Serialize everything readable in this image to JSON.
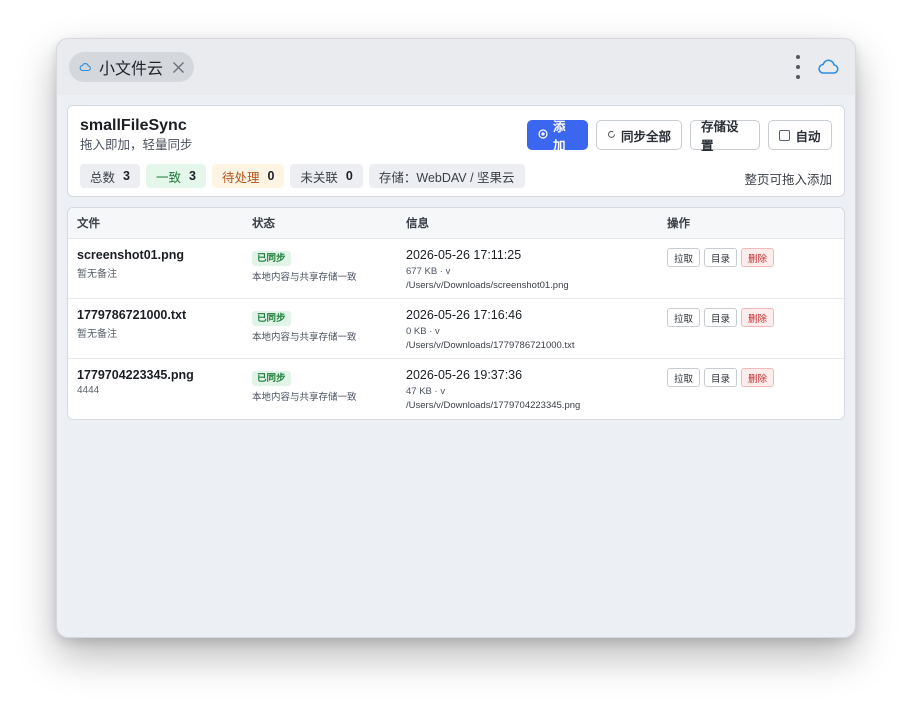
{
  "tab": {
    "title": "小文件云"
  },
  "header": {
    "title": "smallFileSync",
    "subtitle": "拖入即加，轻量同步",
    "buttons": {
      "add": "添加",
      "sync_all": "同步全部",
      "storage_settings": "存储设置",
      "auto": "自动"
    },
    "stats": {
      "total_label": "总数",
      "total_value": "3",
      "ok_label": "一致",
      "ok_value": "3",
      "pending_label": "待处理",
      "pending_value": "0",
      "unlinked_label": "未关联",
      "unlinked_value": "0",
      "storage_text": "存储：WebDAV / 坚果云"
    },
    "drop_hint": "整页可拖入添加"
  },
  "table": {
    "columns": [
      "文件",
      "状态",
      "信息",
      "操作"
    ],
    "rows": [
      {
        "name": "screenshot01.png",
        "note": "暂无备注",
        "status_badge": "已同步",
        "status_desc": "本地内容与共享存储一致",
        "time": "2026-05-26 17:11:25",
        "meta": "677 KB · v",
        "path": "/Users/v/Downloads/screenshot01.png",
        "ops": {
          "pull": "拉取",
          "dir": "目录",
          "delete": "删除"
        }
      },
      {
        "name": "1779786721000.txt",
        "note": "暂无备注",
        "status_badge": "已同步",
        "status_desc": "本地内容与共享存储一致",
        "time": "2026-05-26 17:16:46",
        "meta": "0 KB · v",
        "path": "/Users/v/Downloads/1779786721000.txt",
        "ops": {
          "pull": "拉取",
          "dir": "目录",
          "delete": "删除"
        }
      },
      {
        "name": "1779704223345.png",
        "note": "4444",
        "status_badge": "已同步",
        "status_desc": "本地内容与共享存储一致",
        "time": "2026-05-26 19:37:36",
        "meta": "47 KB · v",
        "path": "/Users/v/Downloads/1779704223345.png",
        "ops": {
          "pull": "拉取",
          "dir": "目录",
          "delete": "删除"
        }
      }
    ]
  },
  "colors": {
    "accent": "#3b67f0",
    "cloud_icon": "#2d8fe0",
    "synced_badge": "#1e7f3c",
    "delete": "#c42b2b"
  },
  "icons": {
    "tab": "cloud-icon",
    "close": "close-icon",
    "menu": "kebab-menu-icon",
    "cloud": "cloud-icon",
    "add": "plus-circle-icon",
    "sync": "refresh-icon"
  }
}
